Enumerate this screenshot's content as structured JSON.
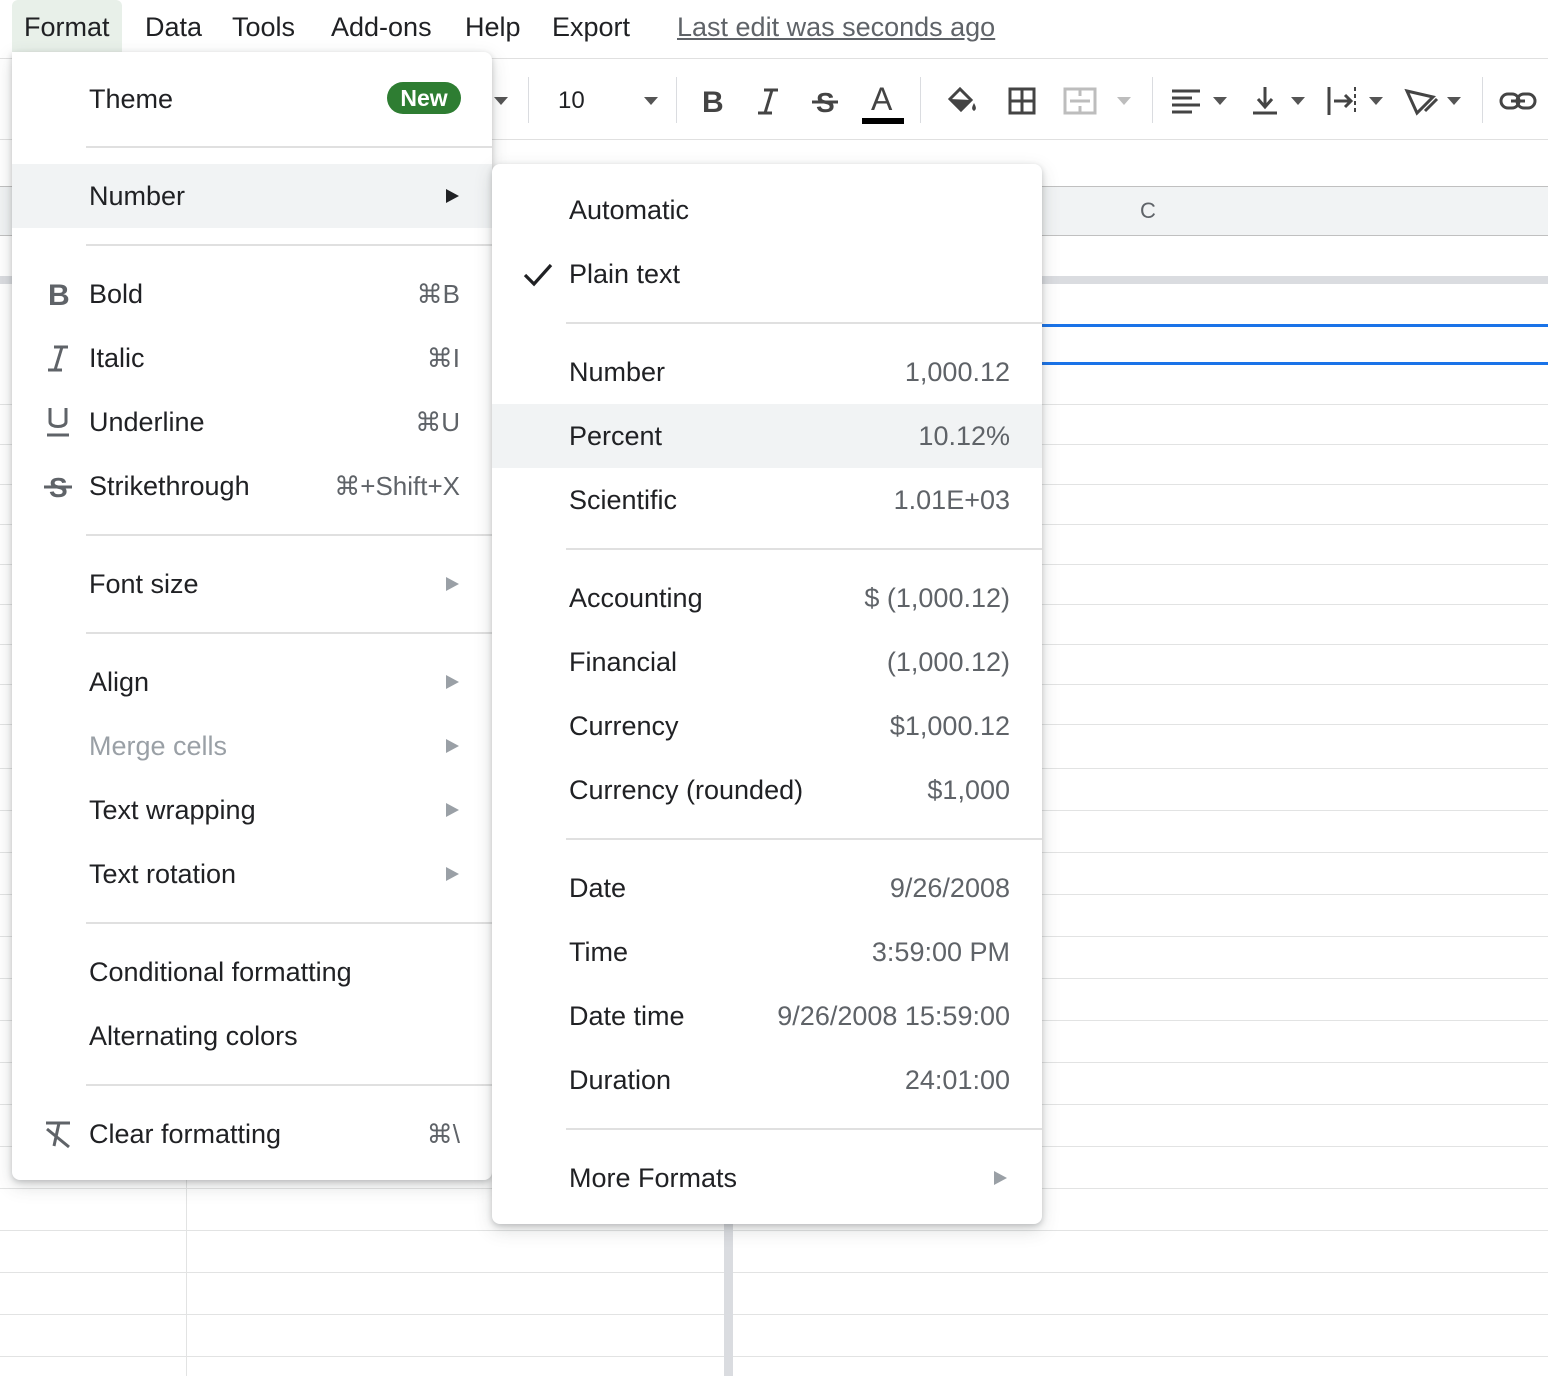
{
  "menubar": {
    "items": [
      {
        "label": "Format"
      },
      {
        "label": "Data"
      },
      {
        "label": "Tools"
      },
      {
        "label": "Add-ons"
      },
      {
        "label": "Help"
      },
      {
        "label": "Export"
      }
    ],
    "last_edit": "Last edit was seconds ago"
  },
  "toolbar": {
    "font_size": "10",
    "icons": [
      "bold-icon",
      "italic-icon",
      "strikethrough-icon",
      "text-color-icon",
      "fill-color-icon",
      "borders-icon",
      "merge-cells-icon",
      "horizontal-align-icon",
      "vertical-align-icon",
      "text-wrapping-icon",
      "text-rotation-icon",
      "insert-link-icon"
    ],
    "text_color": "#000000"
  },
  "grid": {
    "column_c": "C",
    "selection_color": "#1a73e8"
  },
  "format_menu": {
    "theme": {
      "label": "Theme",
      "badge": "New"
    },
    "number": {
      "label": "Number"
    },
    "bold": {
      "label": "Bold",
      "shortcut": "⌘B",
      "icon": "bold-icon"
    },
    "italic": {
      "label": "Italic",
      "shortcut": "⌘I",
      "icon": "italic-icon"
    },
    "underline": {
      "label": "Underline",
      "shortcut": "⌘U",
      "icon": "underline-icon"
    },
    "strikethrough": {
      "label": "Strikethrough",
      "shortcut": "⌘+Shift+X",
      "icon": "strikethrough-icon"
    },
    "font_size": {
      "label": "Font size"
    },
    "align": {
      "label": "Align"
    },
    "merge_cells": {
      "label": "Merge cells",
      "disabled": true
    },
    "text_wrapping": {
      "label": "Text wrapping"
    },
    "text_rotation": {
      "label": "Text rotation"
    },
    "conditional_formatting": {
      "label": "Conditional formatting"
    },
    "alternating_colors": {
      "label": "Alternating colors"
    },
    "clear_formatting": {
      "label": "Clear formatting",
      "shortcut": "⌘\\",
      "icon": "clear-formatting-icon"
    },
    "badge_color": "#2e7d32"
  },
  "number_menu": {
    "automatic": {
      "label": "Automatic"
    },
    "plain_text": {
      "label": "Plain text",
      "checked": true
    },
    "number": {
      "label": "Number",
      "example": "1,000.12"
    },
    "percent": {
      "label": "Percent",
      "example": "10.12%"
    },
    "scientific": {
      "label": "Scientific",
      "example": "1.01E+03"
    },
    "accounting": {
      "label": "Accounting",
      "example": "$ (1,000.12)"
    },
    "financial": {
      "label": "Financial",
      "example": "(1,000.12)"
    },
    "currency": {
      "label": "Currency",
      "example": "$1,000.12"
    },
    "currency_rounded": {
      "label": "Currency (rounded)",
      "example": "$1,000"
    },
    "date": {
      "label": "Date",
      "example": "9/26/2008"
    },
    "time": {
      "label": "Time",
      "example": "3:59:00 PM"
    },
    "date_time": {
      "label": "Date time",
      "example": "9/26/2008 15:59:00"
    },
    "duration": {
      "label": "Duration",
      "example": "24:01:00"
    },
    "more_formats": {
      "label": "More Formats"
    }
  }
}
